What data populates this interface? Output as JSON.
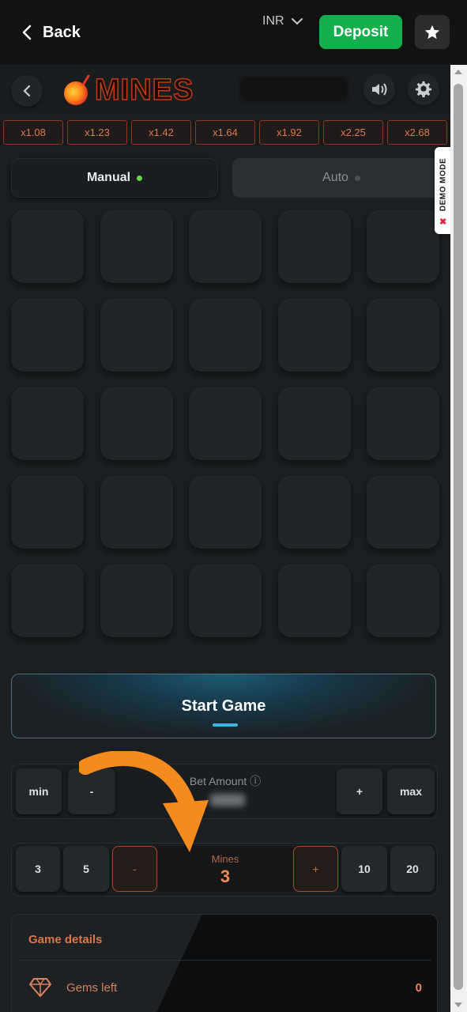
{
  "topbar": {
    "back_label": "Back",
    "currency": "INR",
    "deposit_label": "Deposit"
  },
  "game": {
    "title": "MINES",
    "multipliers": [
      "x1.08",
      "x1.23",
      "x1.42",
      "x1.64",
      "x1.92",
      "x2.25",
      "x2.68"
    ],
    "tabs": {
      "manual": "Manual",
      "auto": "Auto"
    },
    "start_label": "Start Game",
    "bet": {
      "min_label": "min",
      "minus_label": "-",
      "label": "Bet Amount ⓘ",
      "plus_label": "+",
      "max_label": "max"
    },
    "mines": {
      "preset_1": "3",
      "preset_2": "5",
      "minus_label": "-",
      "label": "Mines",
      "value": "3",
      "plus_label": "+",
      "preset_3": "10",
      "preset_4": "20"
    },
    "details": {
      "title": "Game details",
      "gems_label": "Gems left",
      "gems_value": "0"
    },
    "demo_tag": "DEMO MODE",
    "demo_close": "✖"
  },
  "colors": {
    "accent_orange": "#e07a4c",
    "deposit_green": "#12b04d",
    "start_blue": "#3fb4e0",
    "active_dot": "#6bd14a"
  }
}
